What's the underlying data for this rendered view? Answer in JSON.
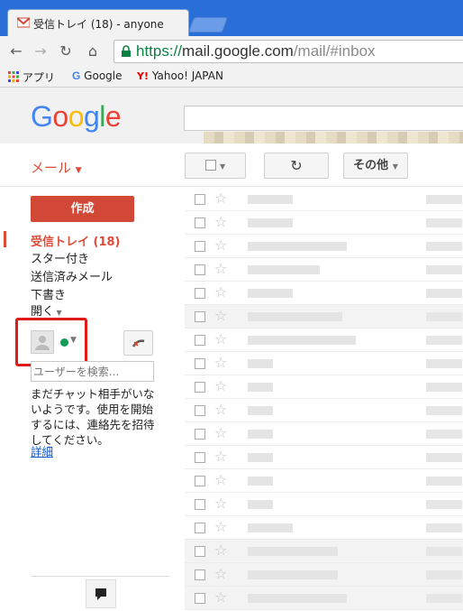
{
  "browser": {
    "tab_title": "受信トレイ (18) - anyone",
    "url_scheme": "https://",
    "url_host": "mail.google.com",
    "url_path": "/mail/#inbox",
    "bookmarks": [
      {
        "label": "アプリ",
        "icon": "apps-grid-icon"
      },
      {
        "label": "Google",
        "icon": "google-g-icon"
      },
      {
        "label": "Yahoo! JAPAN",
        "icon": "yahoo-icon"
      }
    ]
  },
  "gmail": {
    "logo": "Google",
    "mail_label": "メール",
    "more_label": "その他",
    "compose_label": "作成",
    "nav": [
      {
        "label": "受信トレイ (18)",
        "active": true
      },
      {
        "label": "スター付き"
      },
      {
        "label": "送信済みメール"
      },
      {
        "label": "下書き"
      },
      {
        "label": "開く"
      }
    ],
    "chat": {
      "search_placeholder": "ユーザーを検索...",
      "empty_message": "まだチャット相手がいないようです。使用を開始するには、連絡先を招待してください。",
      "details_link": "詳細"
    }
  },
  "colors": {
    "gmail_red": "#dd4b39",
    "compose_red": "#d14836",
    "link_blue": "#1155cc",
    "status_green": "#0f9d58",
    "highlight_red": "#e01a1a"
  }
}
